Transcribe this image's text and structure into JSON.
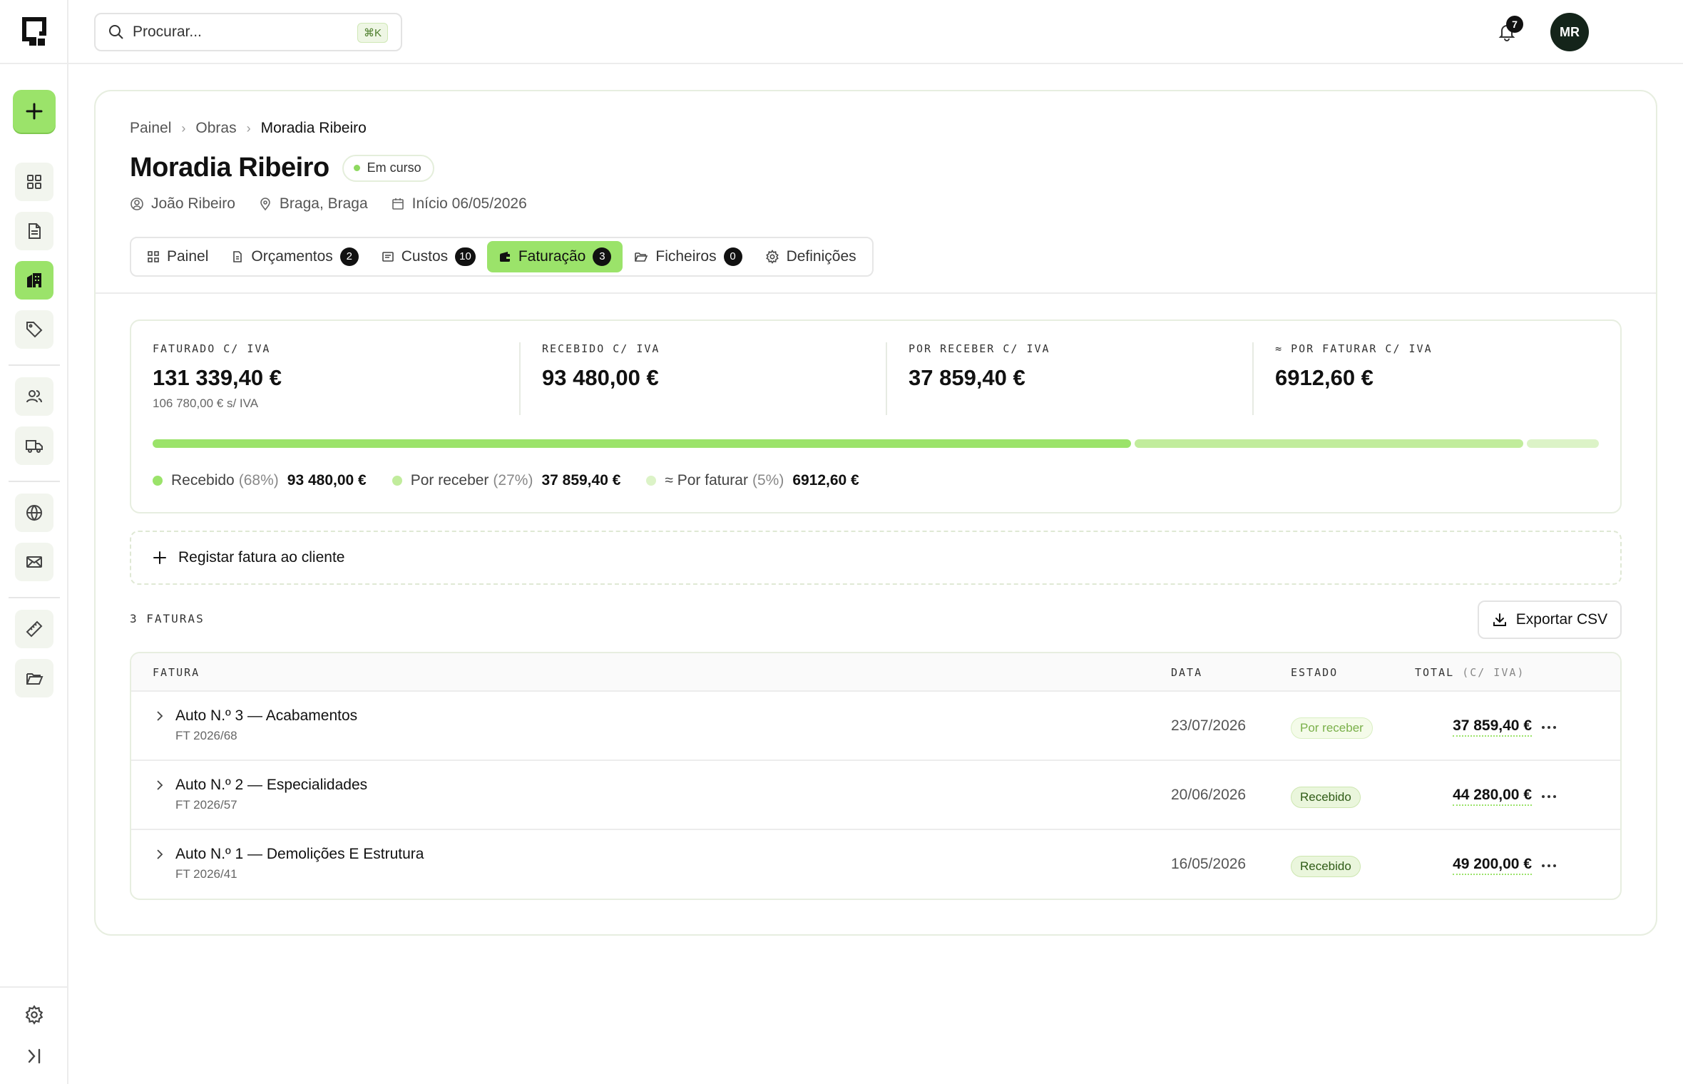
{
  "topbar": {
    "search_placeholder": "Procurar...",
    "search_shortcut": "⌘K",
    "notifications_count": "7",
    "avatar_initials": "MR"
  },
  "sidebar": {
    "icons": [
      "grid-icon",
      "document-icon",
      "building-icon",
      "tag-icon",
      "users-icon",
      "truck-icon",
      "globe-icon",
      "mail-icon",
      "ruler-icon",
      "folder-icon"
    ],
    "active": "building-icon"
  },
  "breadcrumb": {
    "items": [
      "Painel",
      "Obras",
      "Moradia Ribeiro"
    ]
  },
  "project": {
    "title": "Moradia Ribeiro",
    "status": "Em curso",
    "client": "João Ribeiro",
    "location": "Braga, Braga",
    "start": "Início 06/05/2026"
  },
  "tabs": [
    {
      "label": "Painel",
      "badge": null
    },
    {
      "label": "Orçamentos",
      "badge": "2"
    },
    {
      "label": "Custos",
      "badge": "10"
    },
    {
      "label": "Faturação",
      "badge": "3"
    },
    {
      "label": "Ficheiros",
      "badge": "0"
    },
    {
      "label": "Definições",
      "badge": null
    }
  ],
  "stats": {
    "invoiced": {
      "label": "FATURADO C/ IVA",
      "value": "131 339,40 €",
      "sub": "106 780,00 € s/ IVA"
    },
    "received": {
      "label": "RECEBIDO C/ IVA",
      "value": "93 480,00 €"
    },
    "to_receive": {
      "label": "POR RECEBER C/ IVA",
      "value": "37 859,40 €"
    },
    "to_invoice": {
      "prefix": "≈",
      "label": "POR FATURAR C/ IVA",
      "value": "6912,60 €"
    },
    "progress": [
      {
        "name": "Recebido",
        "pct_label": "(68%)",
        "value": "93 480,00 €",
        "fraction": 0.68,
        "color": "#9be36a"
      },
      {
        "name": "Por receber",
        "pct_label": "(27%)",
        "value": "37 859,40 €",
        "fraction": 0.27,
        "color": "#c1ec9c"
      },
      {
        "name": "≈ Por faturar",
        "pct_label": "(5%)",
        "value": "6912,60 €",
        "fraction": 0.05,
        "color": "#dcf3c7"
      }
    ]
  },
  "register_label": "Registar fatura ao cliente",
  "invoices_count": "3 FATURAS",
  "export_label": "Exportar CSV",
  "table": {
    "headers": {
      "invoice": "FATURA",
      "date": "DATA",
      "status": "ESTADO",
      "total": "TOTAL",
      "total_suffix": "(C/ IVA)"
    },
    "rows": [
      {
        "title": "Auto N.º 3 — Acabamentos",
        "ref": "FT 2026/68",
        "date": "23/07/2026",
        "status": "Por receber",
        "status_type": "pending",
        "total": "37 859,40 €"
      },
      {
        "title": "Auto N.º 2 — Especialidades",
        "ref": "FT 2026/57",
        "date": "20/06/2026",
        "status": "Recebido",
        "status_type": "paid",
        "total": "44 280,00 €"
      },
      {
        "title": "Auto N.º 1 — Demolições E Estrutura",
        "ref": "FT 2026/41",
        "date": "16/05/2026",
        "status": "Recebido",
        "status_type": "paid",
        "total": "49 200,00 €"
      }
    ]
  }
}
